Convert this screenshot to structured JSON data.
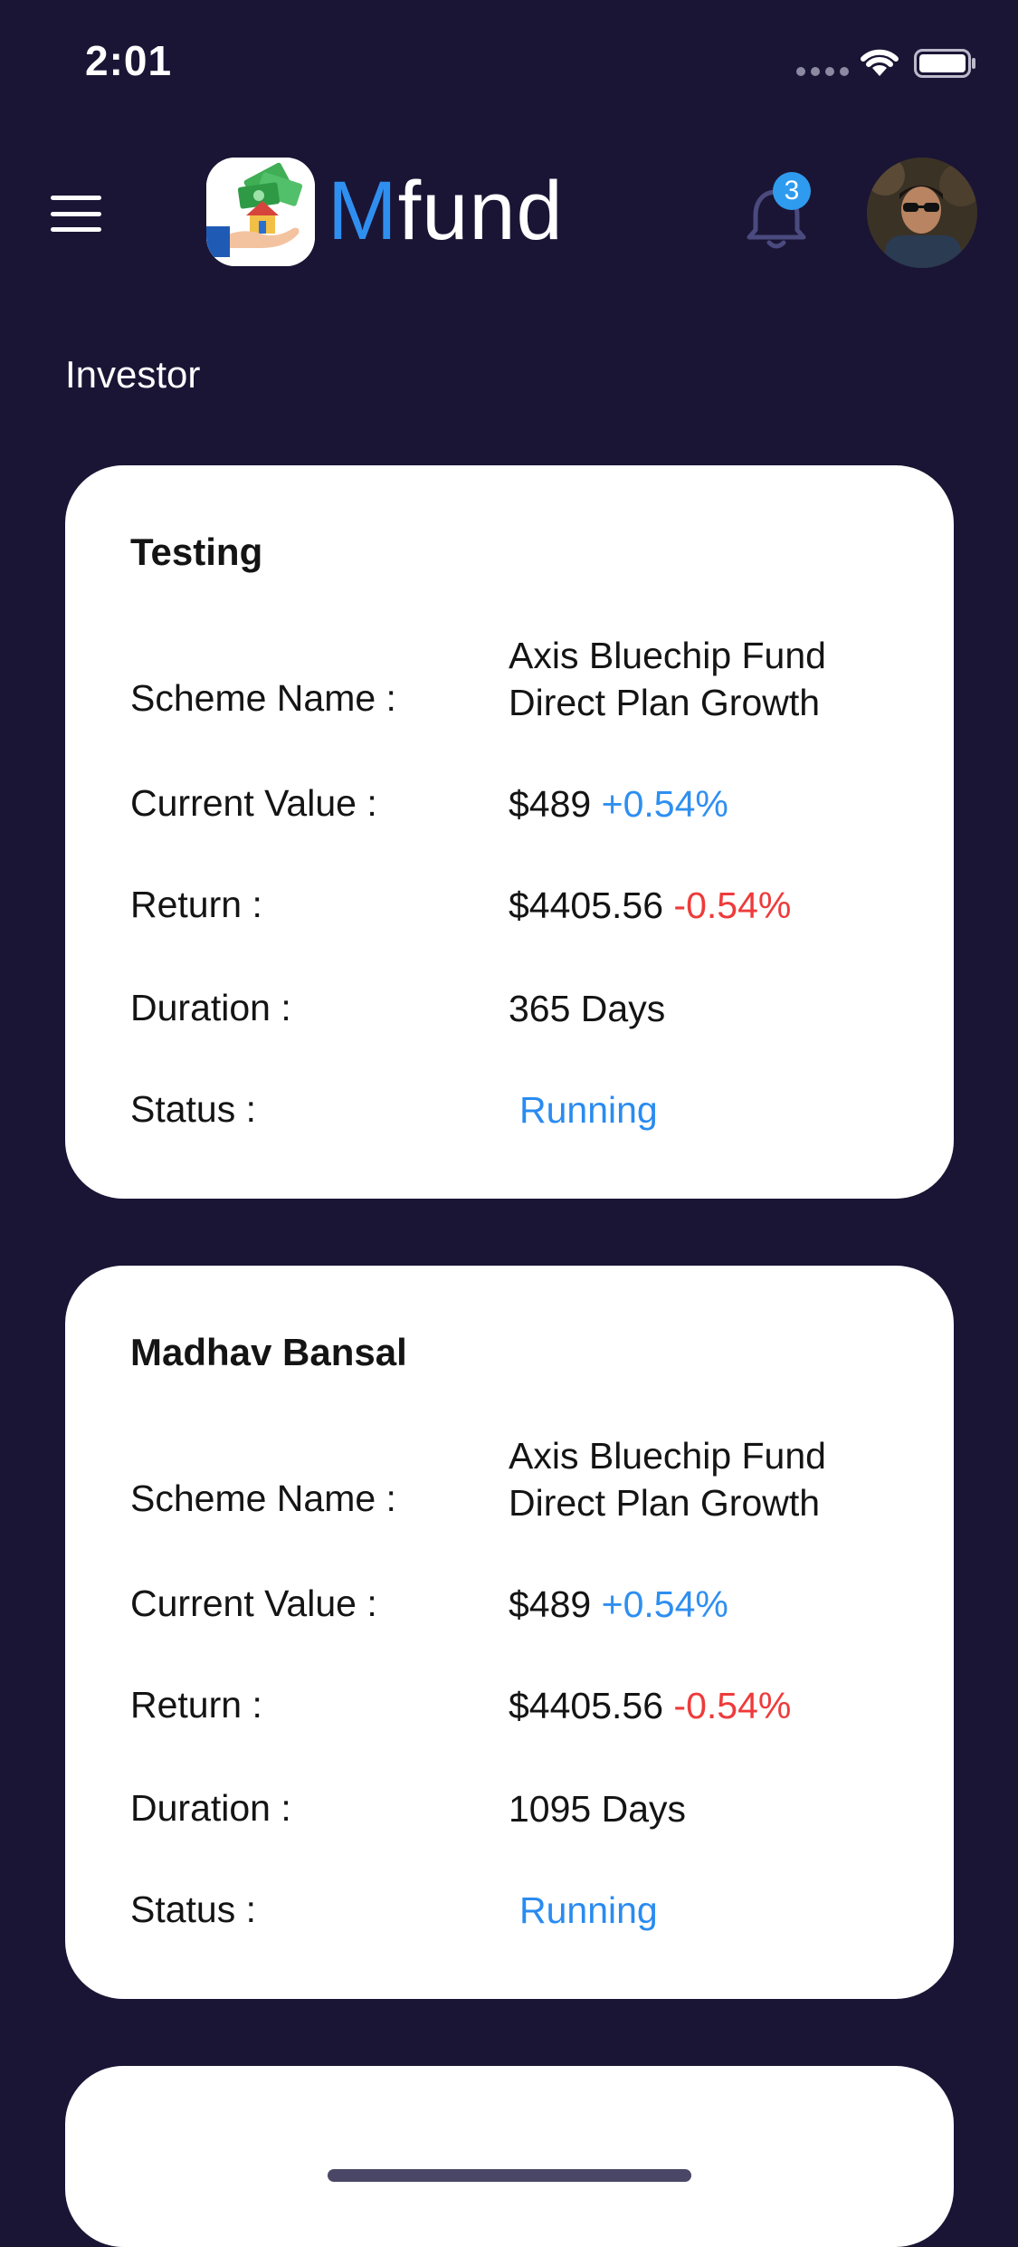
{
  "status_bar": {
    "time": "2:01"
  },
  "header": {
    "brand_accent": "M",
    "brand_rest": "fund",
    "notification_count": "3"
  },
  "section_label": "Investor",
  "labels": {
    "scheme": "Scheme Name :",
    "current_value": "Current Value :",
    "return": "Return :",
    "duration": "Duration :",
    "status": "Status :"
  },
  "cards": [
    {
      "title": "Testing",
      "scheme_line1": "Axis Bluechip Fund",
      "scheme_line2": "Direct Plan Growth",
      "current_value": "$489",
      "current_change": "+0.54%",
      "return_value": "$4405.56",
      "return_change": "-0.54%",
      "duration": "365 Days",
      "status": "Running"
    },
    {
      "title": "Madhav Bansal",
      "scheme_line1": "Axis Bluechip Fund",
      "scheme_line2": "Direct Plan Growth",
      "current_value": "$489",
      "current_change": "+0.54%",
      "return_value": "$4405.56",
      "return_change": "-0.54%",
      "duration": "1095 Days",
      "status": "Running"
    }
  ],
  "colors": {
    "background": "#1a1535",
    "accent": "#2f8ff0",
    "negative": "#ee3b3b",
    "card": "#ffffff"
  }
}
